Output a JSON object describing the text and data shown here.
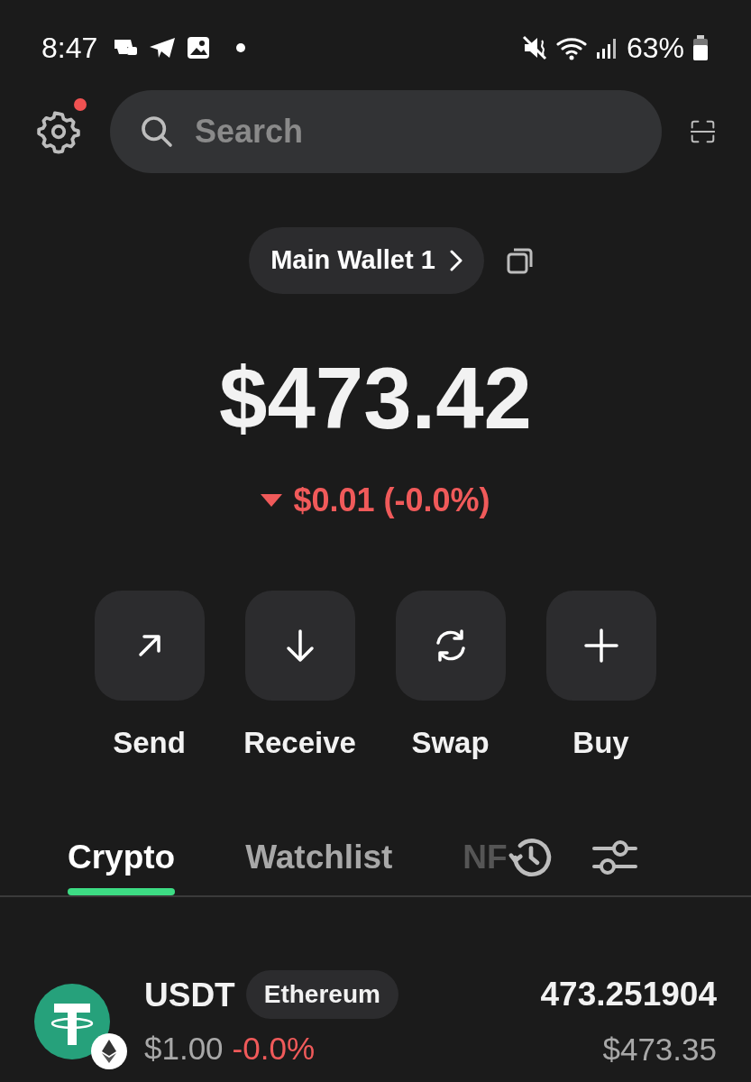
{
  "status_bar": {
    "time": "8:47",
    "battery": "63%"
  },
  "header": {
    "settings_badge": true,
    "search": {
      "placeholder": "Search"
    }
  },
  "wallet": {
    "name": "Main Wallet 1"
  },
  "balance": {
    "amount": "$473.42",
    "change": "$0.01 (-0.0%)",
    "down": true
  },
  "actions": [
    {
      "kind": "send",
      "label": "Send"
    },
    {
      "kind": "receive",
      "label": "Receive"
    },
    {
      "kind": "swap",
      "label": "Swap"
    },
    {
      "kind": "buy",
      "label": "Buy"
    }
  ],
  "tabs": [
    {
      "label": "Crypto",
      "selected": true
    },
    {
      "label": "Watchlist",
      "selected": false
    },
    {
      "label": "NF",
      "selected": false
    }
  ],
  "assets": [
    {
      "symbol": "USDT",
      "network": "Ethereum",
      "price": "$1.00",
      "change": "-0.0%",
      "down": true,
      "amount": "473.251904",
      "value": "$473.35"
    }
  ]
}
